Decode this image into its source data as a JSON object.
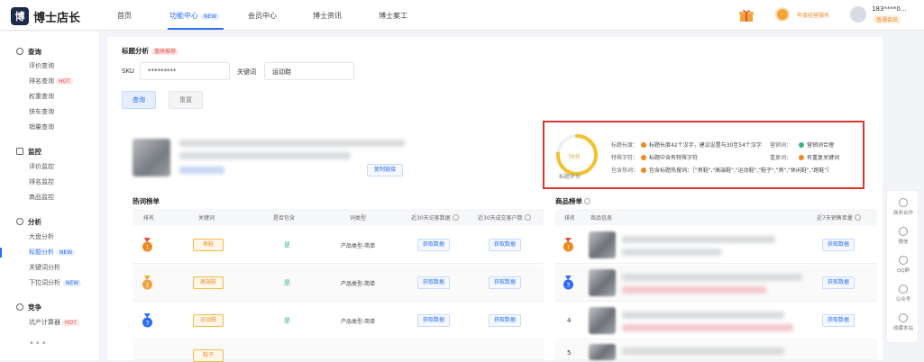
{
  "app": {
    "name": "博士店长",
    "logo_char": "博"
  },
  "nav": {
    "items": [
      "首页",
      "功能中心",
      "会员中心",
      "博士资讯",
      "博士案工"
    ],
    "new_badge": "NEW",
    "vip_text": "年度经营服务",
    "user_phone": "183****0...",
    "user_tag": "普通会员"
  },
  "sidebar": {
    "sections": [
      {
        "title": "查询",
        "items": [
          "评价查询",
          "排名查询",
          "权重查询",
          "快车查询",
          "销量查询"
        ]
      },
      {
        "title": "监控",
        "items": [
          "评价监控",
          "排名监控",
          "商品监控"
        ]
      },
      {
        "title": "分析",
        "items": [
          "大盘分析",
          "标题分析",
          "关键词分析",
          "下拉词分析"
        ]
      },
      {
        "title": "竞争",
        "items": [
          "坑产计算器"
        ]
      }
    ],
    "hot": "HOT",
    "new": "NEW",
    "more": "•••"
  },
  "main": {
    "title": "标题分析",
    "title_tag": "重磅推荐",
    "sku_label": "SKU",
    "sku_value": "*********",
    "kw_label": "关键词",
    "kw_value": "运动鞋",
    "search_btn": "查询",
    "reset_btn": "重置",
    "copy_link": "复制链接"
  },
  "analysis": {
    "score_text": "76分",
    "score_value": 76,
    "score_label": "标题评分",
    "rows": [
      {
        "key": "标题长度：",
        "val": "标题长度42个汉字，建议设置与30至54个汉字",
        "key2": "营销词：",
        "val2": "营销词合理",
        "dot": "o",
        "dot2": "g"
      },
      {
        "key": "特殊字符：",
        "val": "标题中含有特殊字符",
        "key2": "重复词：",
        "val2": "有重复关键词",
        "dot": "o",
        "dot2": "o"
      },
      {
        "key": "包含热词：",
        "val": "包含标题热搜词：［\"男鞋\",\"高端鞋\",\"运动鞋\",\"鞋子\",\"男\",\"休闲鞋\",\"跑鞋\"］",
        "dot": "o"
      }
    ]
  },
  "hot_table": {
    "title": "热词榜单",
    "headers": [
      "排名",
      "关键词",
      "是否包含",
      "词类型",
      "近30天访客数据",
      "近30天成交客户数"
    ],
    "rows": [
      {
        "kw": "男鞋",
        "contains": "是",
        "type": "产品类型-简单",
        "b1": "获取数据",
        "b2": "获取数据"
      },
      {
        "kw": "高端鞋",
        "contains": "是",
        "type": "产品类型-简单",
        "b1": "获取数据",
        "b2": "获取数据"
      },
      {
        "kw": "运动鞋",
        "contains": "是",
        "type": "产品类型-简单",
        "b1": "获取数据",
        "b2": "获取数据"
      },
      {
        "kw": "鞋子",
        "contains": "",
        "type": "",
        "b1": "",
        "b2": ""
      }
    ]
  },
  "product_table": {
    "title": "商品榜单",
    "headers": [
      "排名",
      "商品信息",
      "近7天销售单量"
    ],
    "rows": [
      {
        "rank": "",
        "btn": "获取数据"
      },
      {
        "rank": "",
        "btn": "获取数据"
      },
      {
        "rank": "4",
        "btn": "获取数据"
      },
      {
        "rank": "5",
        "btn": ""
      }
    ]
  },
  "float": {
    "items": [
      "商务合作",
      "微信",
      "QQ群",
      "公众号",
      "收藏本站"
    ]
  },
  "colors": {
    "accent": "#2c6cf5",
    "highlight_border": "#d63a2f",
    "hot": "#f04848",
    "gold": "#f3a53a"
  }
}
